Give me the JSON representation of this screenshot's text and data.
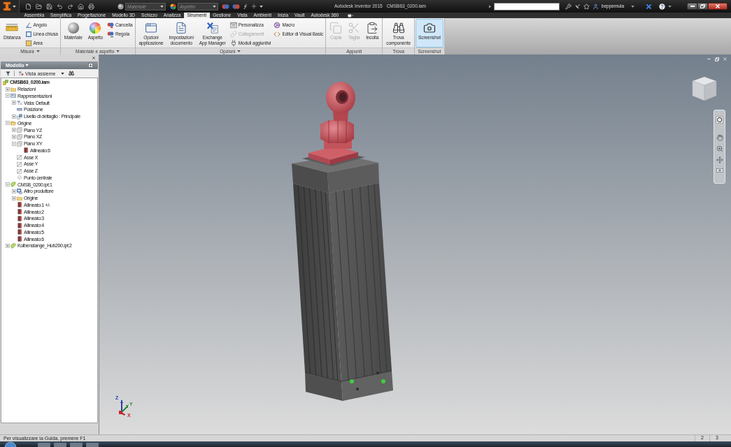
{
  "title_bar": {
    "material_dropdown": {
      "value": "Materiale",
      "disabled": true
    },
    "appearance_dropdown": {
      "value": "Aspetto",
      "disabled": true
    },
    "app_title": "Autodesk Inventor 2015",
    "document": "CMSB63_0200.iam",
    "user": "beppemula"
  },
  "tabs": [
    {
      "label": "Assembla",
      "selected": false
    },
    {
      "label": "Semplifica",
      "selected": false
    },
    {
      "label": "Progettazione",
      "selected": false
    },
    {
      "label": "Modello 3D",
      "selected": false
    },
    {
      "label": "Schizzo",
      "selected": false
    },
    {
      "label": "Analizza",
      "selected": false
    },
    {
      "label": "Strumenti",
      "selected": true
    },
    {
      "label": "Gestione",
      "selected": false
    },
    {
      "label": "Vista",
      "selected": false
    },
    {
      "label": "Ambienti",
      "selected": false
    },
    {
      "label": "Inizia",
      "selected": false
    },
    {
      "label": "Vault",
      "selected": false
    },
    {
      "label": "Autodesk 360",
      "selected": false
    }
  ],
  "ribbon": {
    "panels": [
      {
        "title": "Misura",
        "menu": true,
        "groups": [
          {
            "kind": "large",
            "buttons": [
              {
                "label": "Distanza",
                "disabled": false,
                "highlighted": false
              }
            ]
          },
          {
            "kind": "stack",
            "buttons": [
              {
                "label": "Angolo",
                "disabled": false,
                "highlighted": false
              },
              {
                "label": "Linea chiusa",
                "disabled": false,
                "highlighted": false
              },
              {
                "label": "Area",
                "disabled": false,
                "highlighted": false
              }
            ]
          }
        ]
      },
      {
        "title": "Materiale e aspetto",
        "menu": true,
        "groups": [
          {
            "kind": "large",
            "buttons": [
              {
                "label": "Materiale",
                "disabled": false,
                "highlighted": false
              }
            ]
          },
          {
            "kind": "large",
            "buttons": [
              {
                "label": "Aspetto",
                "disabled": false,
                "highlighted": false
              }
            ]
          },
          {
            "kind": "stack",
            "buttons": [
              {
                "label": "Cancella",
                "disabled": false,
                "highlighted": false
              },
              {
                "label": "Regola",
                "disabled": false,
                "highlighted": false
              }
            ]
          }
        ]
      },
      {
        "title": "Opzioni",
        "menu": true,
        "groups": [
          {
            "kind": "large",
            "buttons": [
              {
                "label": "Opzioni\napplicazione",
                "disabled": false,
                "highlighted": false
              }
            ]
          },
          {
            "kind": "large",
            "buttons": [
              {
                "label": "Impostazioni\ndocumento",
                "disabled": false,
                "highlighted": false
              }
            ]
          },
          {
            "kind": "large",
            "buttons": [
              {
                "label": "Exchange\nApp Manager",
                "disabled": false,
                "highlighted": false
              }
            ]
          },
          {
            "kind": "stack",
            "buttons": [
              {
                "label": "Personalizza",
                "disabled": false,
                "highlighted": false
              },
              {
                "label": "Collegamenti",
                "disabled": true,
                "highlighted": false
              },
              {
                "label": "Moduli aggiuntivi",
                "disabled": false,
                "highlighted": false
              }
            ]
          },
          {
            "kind": "stack",
            "buttons": [
              {
                "label": "Macro",
                "disabled": false,
                "highlighted": false
              },
              {
                "label": "Editor di Visual Basic",
                "disabled": false,
                "highlighted": false
              }
            ]
          }
        ]
      },
      {
        "title": "Appunti",
        "menu": false,
        "groups": [
          {
            "kind": "large",
            "buttons": [
              {
                "label": "Copia",
                "disabled": true,
                "highlighted": false
              }
            ]
          },
          {
            "kind": "large",
            "buttons": [
              {
                "label": "Taglia",
                "disabled": true,
                "highlighted": false
              }
            ]
          },
          {
            "kind": "large",
            "buttons": [
              {
                "label": "Incolla",
                "disabled": false,
                "highlighted": false
              }
            ]
          }
        ]
      },
      {
        "title": "Trova",
        "menu": false,
        "groups": [
          {
            "kind": "large",
            "buttons": [
              {
                "label": "Trova\ncomponente",
                "disabled": false,
                "highlighted": false
              }
            ]
          }
        ]
      },
      {
        "title": "Screenshot",
        "menu": false,
        "groups": [
          {
            "kind": "large",
            "buttons": [
              {
                "label": "Screenshot",
                "disabled": false,
                "highlighted": true
              }
            ]
          }
        ]
      }
    ]
  },
  "browser": {
    "title": "Modello",
    "view_selector": "Vista assieme",
    "tree": {
      "label": "CMSB63_0200.iam",
      "kind": "assembly",
      "children": [
        {
          "label": "Relazioni",
          "kind": "folder",
          "expanded": false
        },
        {
          "label": "Rappresentazioni",
          "kind": "representations",
          "expanded": true,
          "children": [
            {
              "label": "Vista: Default",
              "kind": "view",
              "expanded": false
            },
            {
              "label": "Posizione",
              "kind": "position"
            },
            {
              "label": "Livello di dettaglio : Principale",
              "kind": "detail",
              "expanded": false
            }
          ]
        },
        {
          "label": "Origine",
          "kind": "open-folder",
          "expanded": true,
          "children": [
            {
              "label": "Piano YZ",
              "kind": "plane",
              "expanded": false
            },
            {
              "label": "Piano XZ",
              "kind": "plane",
              "expanded": false
            },
            {
              "label": "Piano XY",
              "kind": "plane",
              "expanded": true,
              "children": [
                {
                  "label": "Allineato:6",
                  "kind": "constraint"
                }
              ]
            },
            {
              "label": "Asse X",
              "kind": "axis"
            },
            {
              "label": "Asse Y",
              "kind": "axis"
            },
            {
              "label": "Asse Z",
              "kind": "axis"
            },
            {
              "label": "Punto centrale",
              "kind": "point"
            }
          ]
        },
        {
          "label": "CMSB_0200.ipt:1",
          "kind": "part",
          "expanded": true,
          "children": [
            {
              "label": "Altro produttore",
              "kind": "derived",
              "expanded": false
            },
            {
              "label": "Origine",
              "kind": "folder",
              "expanded": false
            },
            {
              "label": "Allineato:1 +/-",
              "kind": "constraint"
            },
            {
              "label": "Allineato:2",
              "kind": "constraint"
            },
            {
              "label": "Allineato:3",
              "kind": "constraint"
            },
            {
              "label": "Allineato:4",
              "kind": "constraint"
            },
            {
              "label": "Allineato:5",
              "kind": "constraint"
            },
            {
              "label": "Allineato:6",
              "kind": "constraint"
            }
          ]
        },
        {
          "label": "Kolbenstange_Hub200.ipt:2",
          "kind": "part",
          "expanded": false
        }
      ]
    }
  },
  "viewport": {
    "axes": [
      {
        "label": "Z",
        "color": "#2a3fae"
      },
      {
        "label": "Y",
        "color": "#2e8b3a"
      },
      {
        "label": "X",
        "color": "#c0282d"
      }
    ]
  },
  "status_bar": {
    "message": "Per visualizzare la Guida, premere F1",
    "indicators": [
      "2",
      "3"
    ]
  }
}
